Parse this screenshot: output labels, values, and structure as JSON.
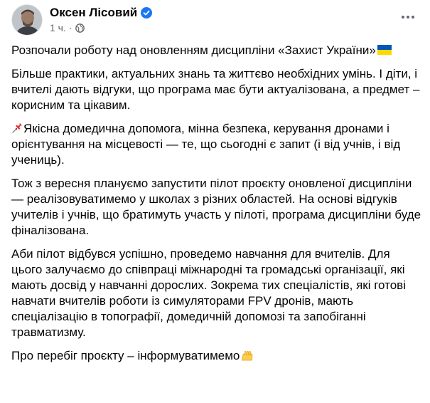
{
  "author": {
    "name": "Оксен Лісовий",
    "verified": true,
    "time": "1 ч.",
    "separator": "·",
    "audience_icon": "globe-icon"
  },
  "post": {
    "p1": "Розпочали роботу над оновленням дисципліни «Захист України»",
    "p1_emoji": "ukraine-flag-icon",
    "p2": "Більше практики, актуальних знань та життєво необхідних умінь. І діти, і вчителі дають відгуки, що програма має бути актуалізована, а предмет – корисним та цікавим.",
    "p3_emoji": "pushpin-icon",
    "p3": "Якісна домедична допомога, мінна безпека, керування дронами і орієнтування на місцевості — те, що сьогодні є запит (і від учнів, і від учениць).",
    "p4": "Тож з вересня плануємо запустити пілот проєкту оновленої дисципліни — реалізовуватимемо у школах з різних областей. На основі відгуків учителів і учнів, що братимуть участь у пілоті, програма дисципліни буде фіналізована.",
    "p5": "Аби пілот відбувся успішно, проведемо навчання для вчителів. Для цього залучаємо до співпраці міжнародні та громадські організації, які мають досвід у навчанні дорослих. Зокрема тих спеціалістів, які готові навчати вчителів роботи із симуляторами FPV дронів, мають спеціалізацію в топографії, домедичній допомозі та запобіганні травматизму.",
    "p6": "Про перебіг проєкту – інформуватимемо",
    "p6_emoji": "raising-hands-icon"
  },
  "colors": {
    "text": "#050505",
    "secondary": "#65676b",
    "verified_badge": "#1877f2",
    "flag_blue": "#0057b7",
    "flag_yellow": "#ffd700"
  }
}
